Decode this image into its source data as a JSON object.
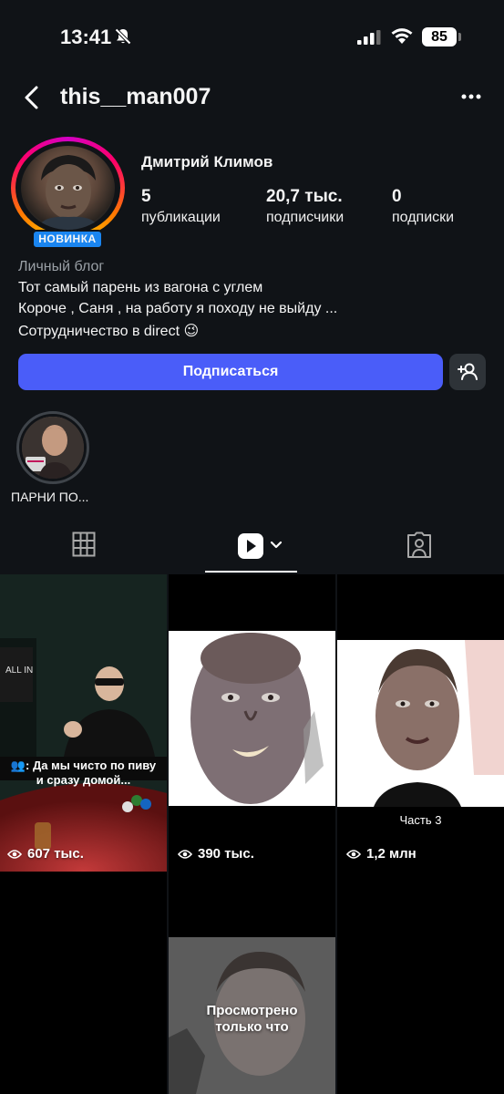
{
  "status": {
    "time": "13:41",
    "battery": "85"
  },
  "header": {
    "username": "this__man007"
  },
  "profile": {
    "badge": "НОВИНКА",
    "full_name": "Дмитрий Климов",
    "stats": [
      {
        "value": "5",
        "label": "публикации"
      },
      {
        "value": "20,7 тыс.",
        "label": "подписчики"
      },
      {
        "value": "0",
        "label": "подписки"
      }
    ],
    "category": "Личный блог",
    "bio": [
      "Тот самый парень из вагона с углем",
      "Короче , Саня , на работу я походу не выйду ...",
      "Сотрудничество в direct 😉"
    ],
    "subscribe_label": "Подписаться"
  },
  "highlights": [
    {
      "label": "ПАРНИ ПО..."
    }
  ],
  "tabs": {
    "active": "reels"
  },
  "reels": [
    {
      "views": "607 тыс.",
      "caption": "👥: Да мы чисто по пиву\nи сразу домой..."
    },
    {
      "views": "390 тыс."
    },
    {
      "views": "1,2 млн",
      "caption": "Часть 3"
    },
    {
      "overlay": "Просмотрено\nтолько что"
    }
  ],
  "colors": {
    "accent": "#4a5df9",
    "badge": "#1a85f0",
    "background": "#101317"
  }
}
